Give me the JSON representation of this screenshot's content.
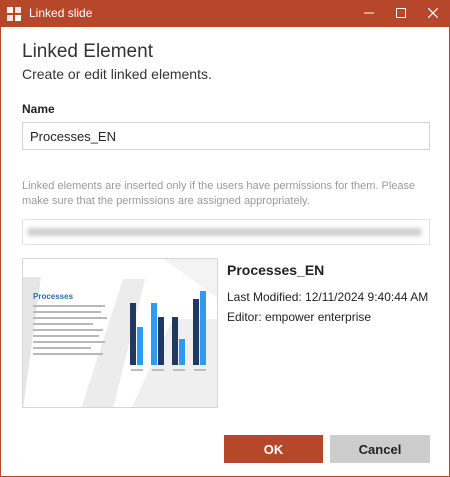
{
  "window": {
    "title": "Linked slide",
    "icon": "linked-slide-icon",
    "controls": {
      "minimize": "minimize-icon",
      "maximize": "maximize-icon",
      "close": "close-icon"
    }
  },
  "header": {
    "title": "Linked Element",
    "subtitle": "Create or edit linked elements."
  },
  "form": {
    "name_label": "Name",
    "name_value": "Processes_EN",
    "info_text": "Linked elements are inserted only if the users have permissions for them. Please make sure that the permissions are assigned appropriately."
  },
  "preview": {
    "slide_title": "Processes",
    "doc_name": "Processes_EN",
    "last_modified": "Last Modified: 12/11/2024 9:40:44 AM",
    "editor": "Editor: empower enterprise"
  },
  "buttons": {
    "ok": "OK",
    "cancel": "Cancel"
  },
  "colors": {
    "accent": "#b7472a",
    "cancel_bg": "#cdcdcd",
    "chart_dark": "#1f3864",
    "chart_light": "#2e9bf0"
  }
}
